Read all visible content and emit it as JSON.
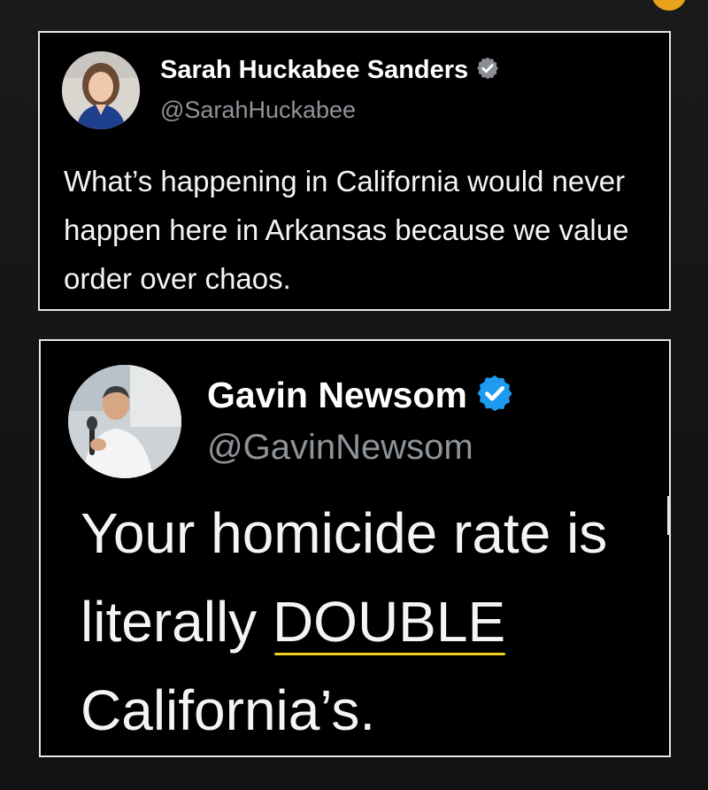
{
  "tweets": [
    {
      "author_name": "Sarah Huckabee Sanders",
      "handle": "@SarahHuckabee",
      "verified": true,
      "badge_color": "#8a8d91",
      "text": "What’s happening in California would never happen here in Arkansas because we value order over chaos."
    },
    {
      "author_name": "Gavin Newsom",
      "handle": "@GavinNewsom",
      "verified": true,
      "badge_color": "#1d9bf0",
      "text_before": "Your homicide rate is literally ",
      "text_highlight": "DOUBLE",
      "text_after": " California’s.",
      "highlight_color": "#f0d020"
    }
  ],
  "icons": {
    "verified": "verified-badge-icon",
    "corner": "emoji-partial-icon"
  }
}
